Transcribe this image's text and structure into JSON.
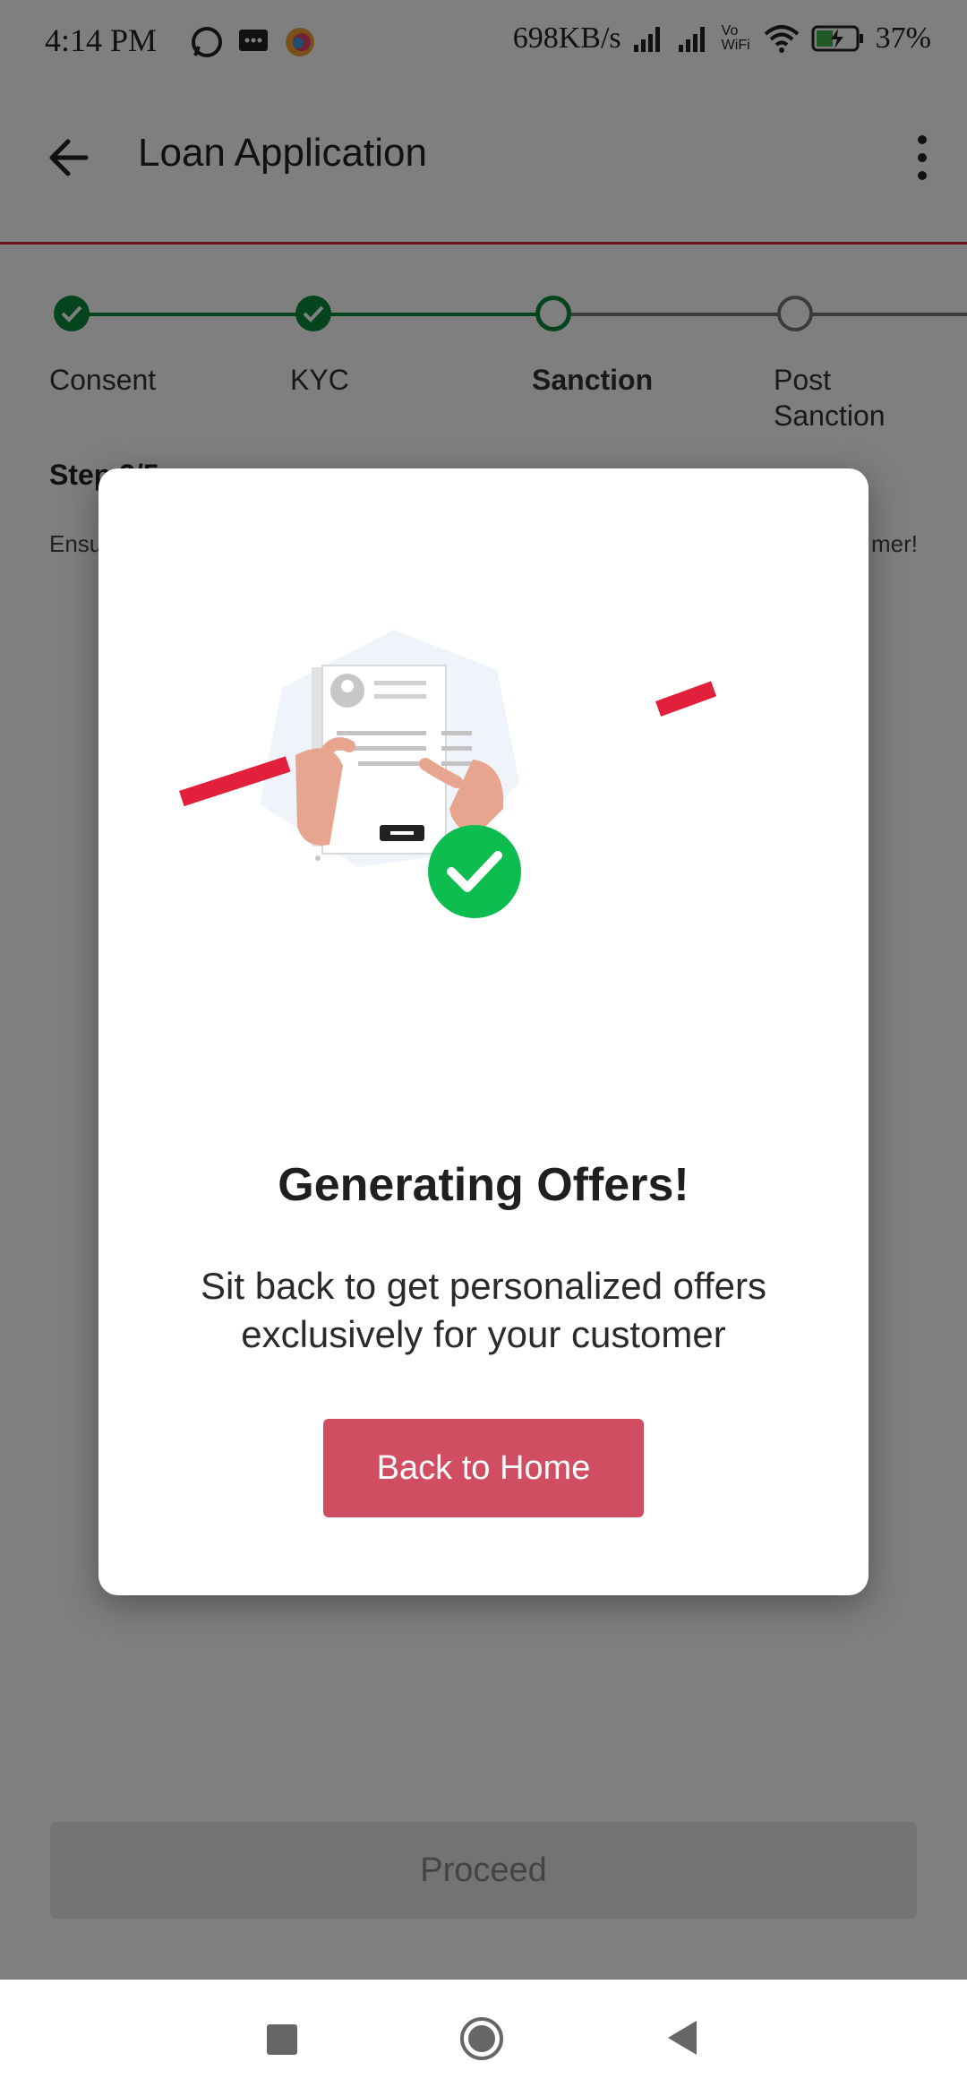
{
  "status_bar": {
    "time": "4:14 PM",
    "network_speed": "698KB/s",
    "wifi_label": "Vo WiFi",
    "battery": "37%",
    "left_icons": [
      "whatsapp-icon",
      "message-icon",
      "browser-icon"
    ],
    "right_icons": [
      "signal-icon",
      "signal-icon",
      "wifi-icon",
      "battery-charging-icon"
    ]
  },
  "app_bar": {
    "title": "Loan Application",
    "back_icon": "arrow-left-icon",
    "more_icon": "more-vertical-icon"
  },
  "stepper": {
    "steps": [
      {
        "label": "Consent",
        "state": "done"
      },
      {
        "label": "KYC",
        "state": "done"
      },
      {
        "label": "Sanction",
        "state": "active"
      },
      {
        "label": "Post Sanction",
        "state": "todo"
      }
    ],
    "done_color": "#0b8a3a"
  },
  "step_info": {
    "step_number": "Step 3/5",
    "hint_left": "Ensu",
    "hint_right": "mer!"
  },
  "footer": {
    "proceed_label": "Proceed"
  },
  "modal": {
    "title": "Generating Offers!",
    "subtitle": "Sit back to get personalized offers exclusively for your customer",
    "button_label": "Back to Home",
    "illustration": "document-approved-illustration",
    "button_color": "#d14e62",
    "accent_color": "#e3203c"
  },
  "nav_bar": {
    "icons": [
      "recents-icon",
      "home-icon",
      "back-icon"
    ]
  }
}
